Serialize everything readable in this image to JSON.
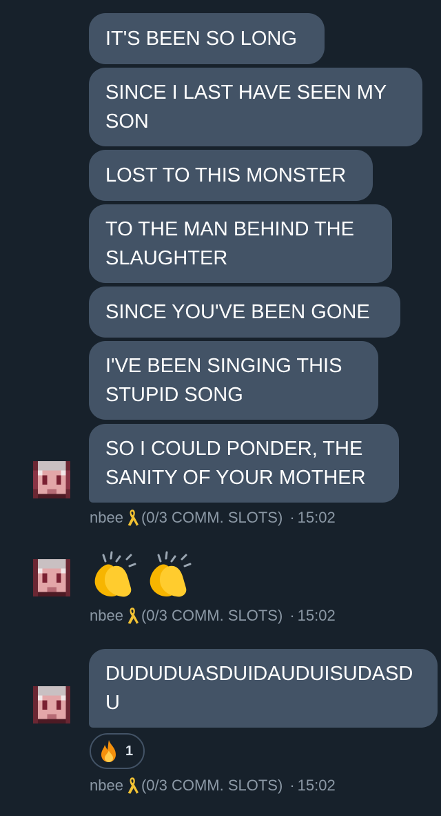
{
  "messages": [
    {
      "text": "IT'S BEEN SO LONG"
    },
    {
      "text": "SINCE I LAST HAVE SEEN MY SON"
    },
    {
      "text": "LOST TO THIS MONSTER"
    },
    {
      "text": "TO THE MAN BEHIND THE SLAUGHTER"
    },
    {
      "text": "SINCE YOU'VE BEEN GONE"
    },
    {
      "text": "I'VE BEEN SINGING THIS STUPID SONG"
    },
    {
      "text": "SO I COULD PONDER, THE SANITY OF YOUR MOTHER"
    },
    {
      "text": "DUDUDUASDUIDAUDUISUDASDU"
    }
  ],
  "meta": {
    "name": "nbee",
    "status": "(0/3 COMM. SLOTS)",
    "separator": "·",
    "time": "15:02"
  },
  "reaction": {
    "emoji_icon": "fire-emoji",
    "count": "1"
  },
  "icons": {
    "ribbon": "yellow-ribbon-icon",
    "clap": "clapping-hands-emoji"
  },
  "colors": {
    "background": "#17212b",
    "bubble": "#435366",
    "meta_text": "#8c99a6",
    "ribbon": "#f2c233"
  }
}
